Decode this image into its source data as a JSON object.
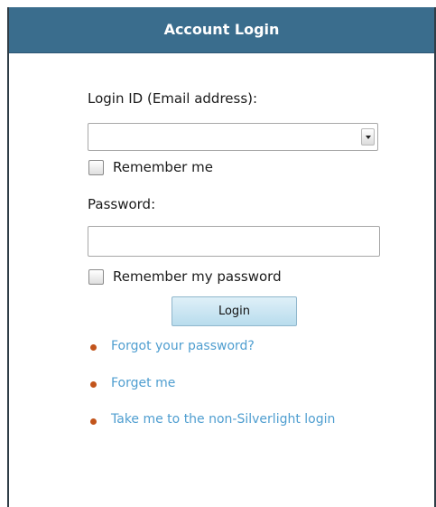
{
  "window": {
    "title": "Account Login"
  },
  "form": {
    "login_label": "Login ID (Email address):",
    "login_value": "",
    "remember_me_label": "Remember me",
    "password_label": "Password:",
    "password_value": "",
    "remember_password_label": "Remember my password",
    "login_button_label": "Login"
  },
  "links": [
    {
      "label": "Forgot your password?"
    },
    {
      "label": "Forget me"
    },
    {
      "label": "Take me to the non-Silverlight login"
    }
  ],
  "colors": {
    "titlebar": "#3a6d8d",
    "link": "#4f9ed0",
    "bullet": "#c2541b"
  }
}
